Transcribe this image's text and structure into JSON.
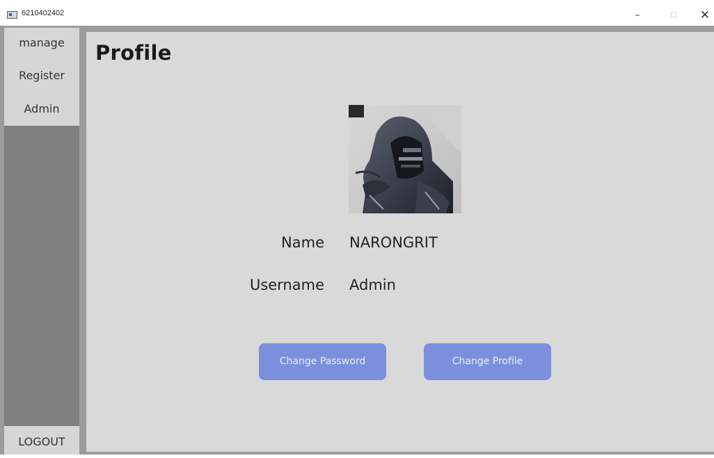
{
  "window": {
    "title": "6210402402",
    "minimize_glyph": "–",
    "maximize_glyph": "☐",
    "close_glyph": "✕"
  },
  "sidebar": {
    "items": [
      {
        "label": "manage"
      },
      {
        "label": "Register"
      },
      {
        "label": "Admin"
      }
    ],
    "logout_label": "LOGOUT"
  },
  "profile": {
    "title": "Profile",
    "avatar_icon": "hooded-figure-avatar",
    "name_label": "Name",
    "name_value": "NARONGRIT",
    "username_label": "Username",
    "username_value": "Admin"
  },
  "actions": {
    "change_password": "Change Password",
    "change_profile": "Change Profile"
  },
  "colors": {
    "button_bg": "#7b8fdc",
    "main_bg": "#d9d9d9",
    "sidebar_bg": "#7f7f7f",
    "nav_bg": "#d6d6d6"
  }
}
